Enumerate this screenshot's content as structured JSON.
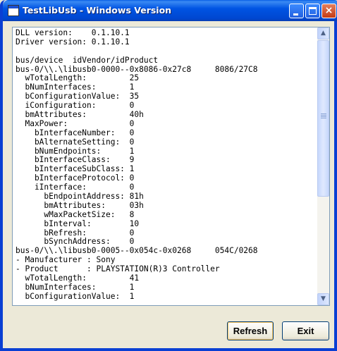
{
  "window": {
    "title": "TestLibUsb - Windows Version",
    "controls": {
      "minimize": "minimize",
      "maximize": "maximize",
      "close": "×"
    }
  },
  "output_lines": [
    "DLL version:    0.1.10.1",
    "Driver version: 0.1.10.1",
    "",
    "bus/device  idVendor/idProduct",
    "bus-0/\\\\.\\libusb0-0000--0x8086-0x27c8     8086/27C8",
    "  wTotalLength:         25",
    "  bNumInterfaces:       1",
    "  bConfigurationValue:  35",
    "  iConfiguration:       0",
    "  bmAttributes:         40h",
    "  MaxPower:             0",
    "    bInterfaceNumber:   0",
    "    bAlternateSetting:  0",
    "    bNumEndpoints:      1",
    "    bInterfaceClass:    9",
    "    bInterfaceSubClass: 1",
    "    bInterfaceProtocol: 0",
    "    iInterface:         0",
    "      bEndpointAddress: 81h",
    "      bmAttributes:     03h",
    "      wMaxPacketSize:   8",
    "      bInterval:        10",
    "      bRefresh:         0",
    "      bSynchAddress:    0",
    "bus-0/\\\\.\\libusb0-0005--0x054c-0x0268     054C/0268",
    "- Manufacturer : Sony",
    "- Product      : PLAYSTATION(R)3 Controller",
    "  wTotalLength:         41",
    "  bNumInterfaces:       1",
    "  bConfigurationValue:  1"
  ],
  "scrollbar": {
    "up_arrow": "▲",
    "down_arrow": "▼"
  },
  "buttons": {
    "refresh": "Refresh",
    "exit": "Exit"
  }
}
